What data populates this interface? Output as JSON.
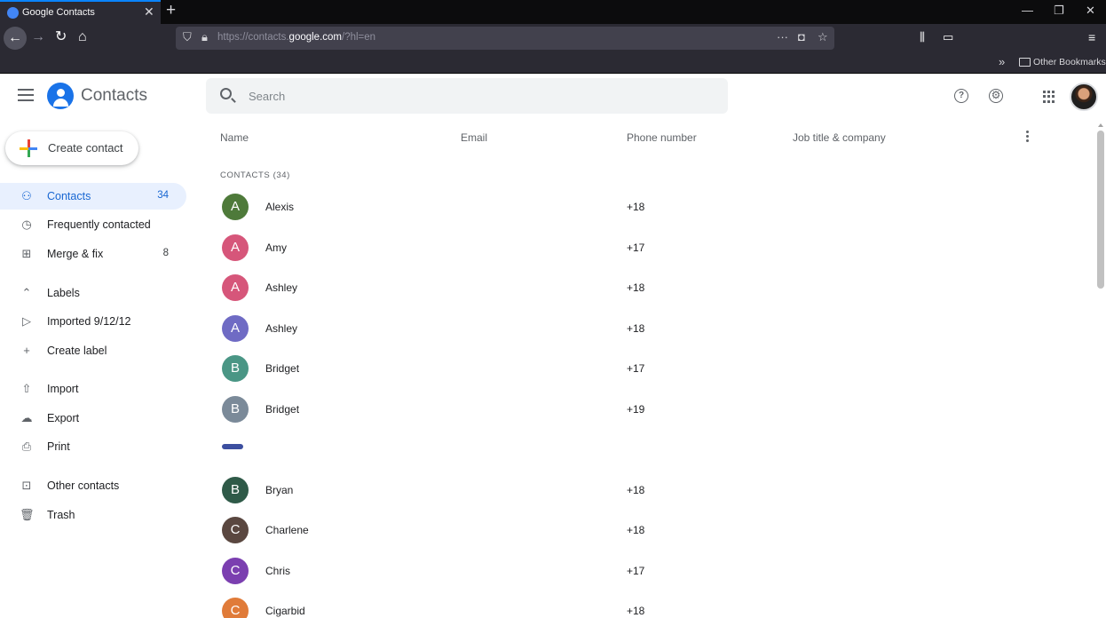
{
  "browser": {
    "tab_title": "Google Contacts",
    "url_prefix": "https://contacts.",
    "url_host": "google.com",
    "url_path": "/?hl=en",
    "bookmarks_label": "Other Bookmarks"
  },
  "header": {
    "app_title": "Contacts",
    "search_placeholder": "Search",
    "help_icon": "?",
    "settings_icon": "⚙"
  },
  "sidebar": {
    "create_label": "Create contact",
    "items": [
      {
        "label": "Contacts",
        "count": "34",
        "icon": "person-icon"
      },
      {
        "label": "Frequently contacted",
        "count": "",
        "icon": "history-icon"
      },
      {
        "label": "Merge & fix",
        "count": "8",
        "icon": "merge-icon"
      },
      {
        "label": "Labels",
        "count": "",
        "icon": "chevron-up-icon"
      },
      {
        "label": "Imported 9/12/12",
        "count": "",
        "icon": "label-icon"
      },
      {
        "label": "Create label",
        "count": "",
        "icon": "plus-icon"
      },
      {
        "label": "Import",
        "count": "",
        "icon": "upload-icon"
      },
      {
        "label": "Export",
        "count": "",
        "icon": "cloud-download-icon"
      },
      {
        "label": "Print",
        "count": "",
        "icon": "print-icon"
      },
      {
        "label": "Other contacts",
        "count": "",
        "icon": "archive-icon"
      },
      {
        "label": "Trash",
        "count": "",
        "icon": "trash-icon"
      }
    ]
  },
  "table": {
    "columns": [
      "Name",
      "Email",
      "Phone number",
      "Job title & company"
    ],
    "section_label": "CONTACTS (34)",
    "rows": [
      {
        "initial": "A",
        "name": "Alexis",
        "phone": "+18",
        "color": "#4e7a3a"
      },
      {
        "initial": "A",
        "name": "Amy",
        "phone": "+17",
        "color": "#d6567a"
      },
      {
        "initial": "A",
        "name": "Ashley",
        "phone": "+18",
        "color": "#d6567a"
      },
      {
        "initial": "A",
        "name": "Ashley",
        "phone": "+18",
        "color": "#6f6bc4"
      },
      {
        "initial": "B",
        "name": "Bridget",
        "phone": "+17",
        "color": "#4a9685"
      },
      {
        "initial": "B",
        "name": "Bridget",
        "phone": "+19",
        "color": "#7b8a99"
      },
      {
        "initial": "B",
        "name": "Bryan",
        "phone": "+18",
        "color": "#2f5a48"
      },
      {
        "initial": "C",
        "name": "Charlene",
        "phone": "+18",
        "color": "#5a4740"
      },
      {
        "initial": "C",
        "name": "Chris",
        "phone": "+17",
        "color": "#7b3fb0"
      },
      {
        "initial": "C",
        "name": "Cigarbid",
        "phone": "+18",
        "color": "#e07b39"
      }
    ]
  }
}
